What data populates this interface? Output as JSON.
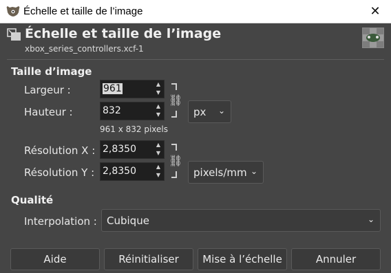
{
  "window": {
    "title": "Échelle et taille de l’image",
    "close_glyph": "✕"
  },
  "header": {
    "title": "Échelle et taille de l’image",
    "subtitle": "xbox_series_controllers.xcf-1"
  },
  "image_size": {
    "section_title": "Taille d’image",
    "width_label": "Largeur :",
    "width_value": "961",
    "height_label": "Hauteur :",
    "height_value": "832",
    "size_info": "961 x 832 pixels",
    "unit": "px",
    "res_x_label": "Résolution X :",
    "res_x_value": "2,8350",
    "res_y_label": "Résolution Y :",
    "res_y_value": "2,8350",
    "res_unit": "pixels/mm"
  },
  "quality": {
    "section_title": "Qualité",
    "interpolation_label": "Interpolation :",
    "interpolation_value": "Cubique"
  },
  "buttons": {
    "help": "Aide",
    "reset": "Réinitialiser",
    "scale": "Mise à l’échelle",
    "cancel": "Annuler"
  },
  "icons": {
    "app": "gimp-icon",
    "header": "scale-image-icon",
    "chain": "chain-link-icon",
    "chevron": "chevron-down-icon",
    "spin_up": "spin-up-icon",
    "spin_down": "spin-down-icon"
  }
}
